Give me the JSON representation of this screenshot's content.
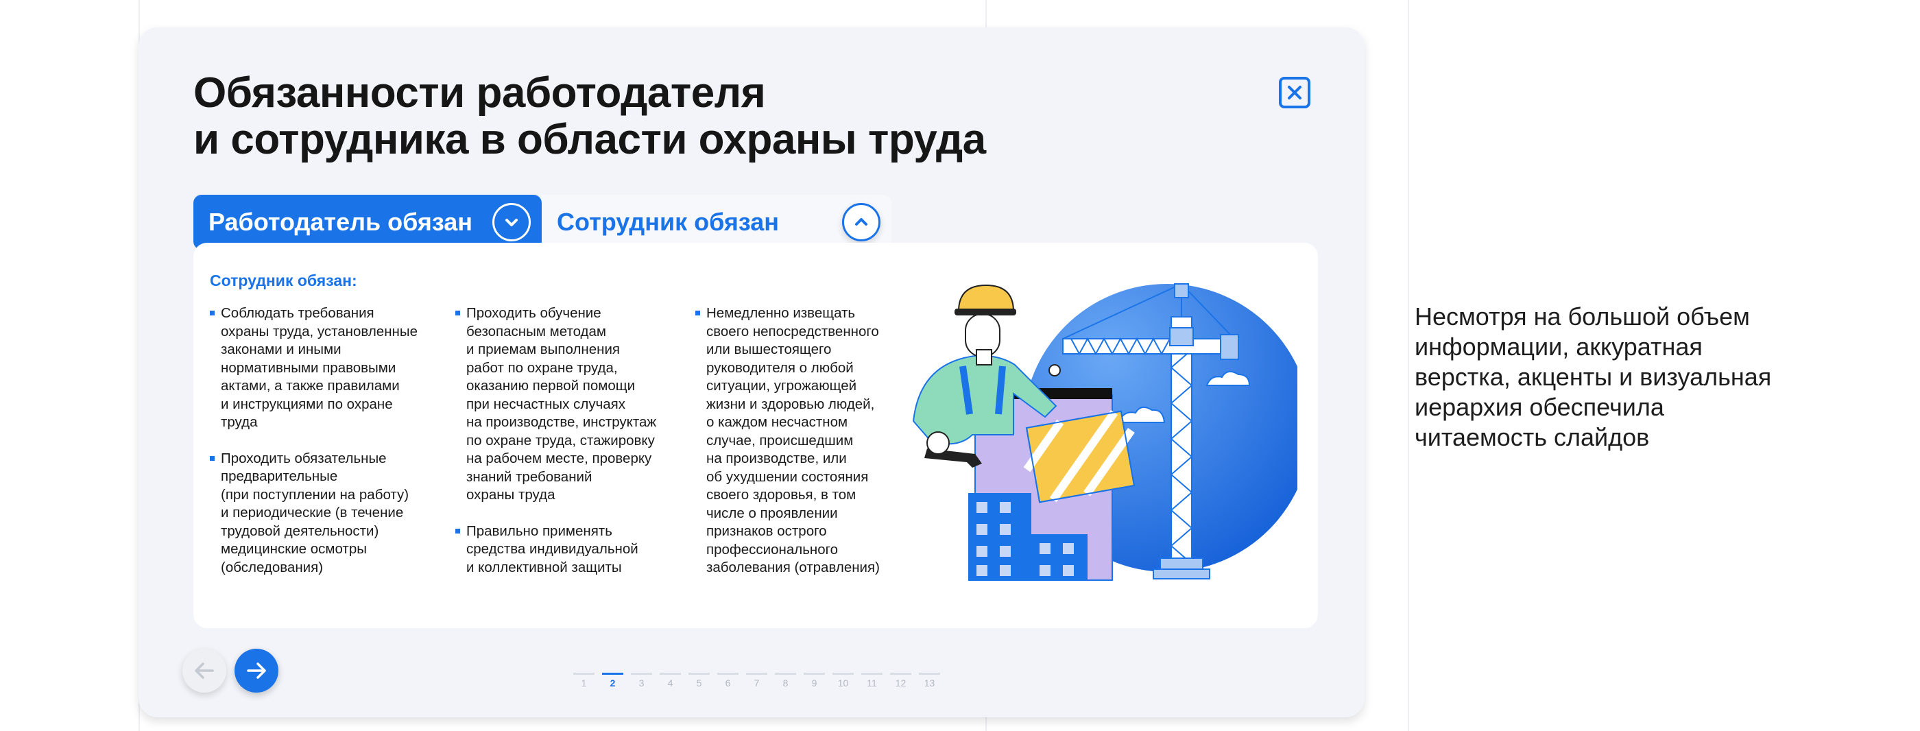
{
  "slide": {
    "title_line1": "Обязанности работодателя",
    "title_line2": "и сотрудника в области охраны труда",
    "close_icon": "close-icon",
    "tabs": [
      {
        "label": "Работодатель обязан",
        "icon": "chevron-down-icon",
        "active": true
      },
      {
        "label": "Сотрудник обязан",
        "icon": "chevron-up-icon",
        "active": false
      }
    ],
    "panel": {
      "heading": "Сотрудник обязан:",
      "col1": [
        "Соблюдать требования\nохраны труда, установленные\nзаконами и иными\nнормативными правовыми\nактами, а также правилами\nи инструкциями по охране\nтруда",
        "Проходить обязательные\nпредварительные\n(при поступлении на работу)\nи периодические (в течение\nтрудовой деятельности)\nмедицинские осмотры\n(обследования)"
      ],
      "col2": [
        "Проходить обучение\nбезопасным методам\nи приемам выполнения\nработ по охране труда,\nоказанию первой помощи\nпри несчастных случаях\nна производстве, инструктаж\nпо охране труда, стажировку\nна рабочем месте, проверку\nзнаний требований\nохраны труда",
        "Правильно применять\nсредства индивидуальной\nи коллективной защиты"
      ],
      "col3": [
        "Немедленно извещать\nсвоего непосредственного\nили вышестоящего\nруководителя о любой\nситуации, угрожающей\nжизни и здоровью людей,\nо каждом несчастном\nслучае, происшедшим\nна производстве, или\nоб ухудшении состояния\nсвоего здоровья, в том\nчисле о проявлении\nпризнаков острого\nпрофессионального\nзаболевания (отравления)"
      ]
    },
    "nav": {
      "prev_icon": "arrow-left-icon",
      "next_icon": "arrow-right-icon",
      "pages": [
        "1",
        "2",
        "3",
        "4",
        "5",
        "6",
        "7",
        "8",
        "9",
        "10",
        "11",
        "12",
        "13"
      ],
      "current_page": "2"
    }
  },
  "side_note": {
    "lines": [
      "Несмотря на большой объем",
      "информации, аккуратная",
      "верстка, акценты и визуальная",
      "иерархия обеспечила",
      "читаемость слайдов"
    ]
  },
  "colors": {
    "accent": "#1a74e8",
    "card_bg": "#f2f4f9",
    "panel_bg": "#ffffff"
  }
}
